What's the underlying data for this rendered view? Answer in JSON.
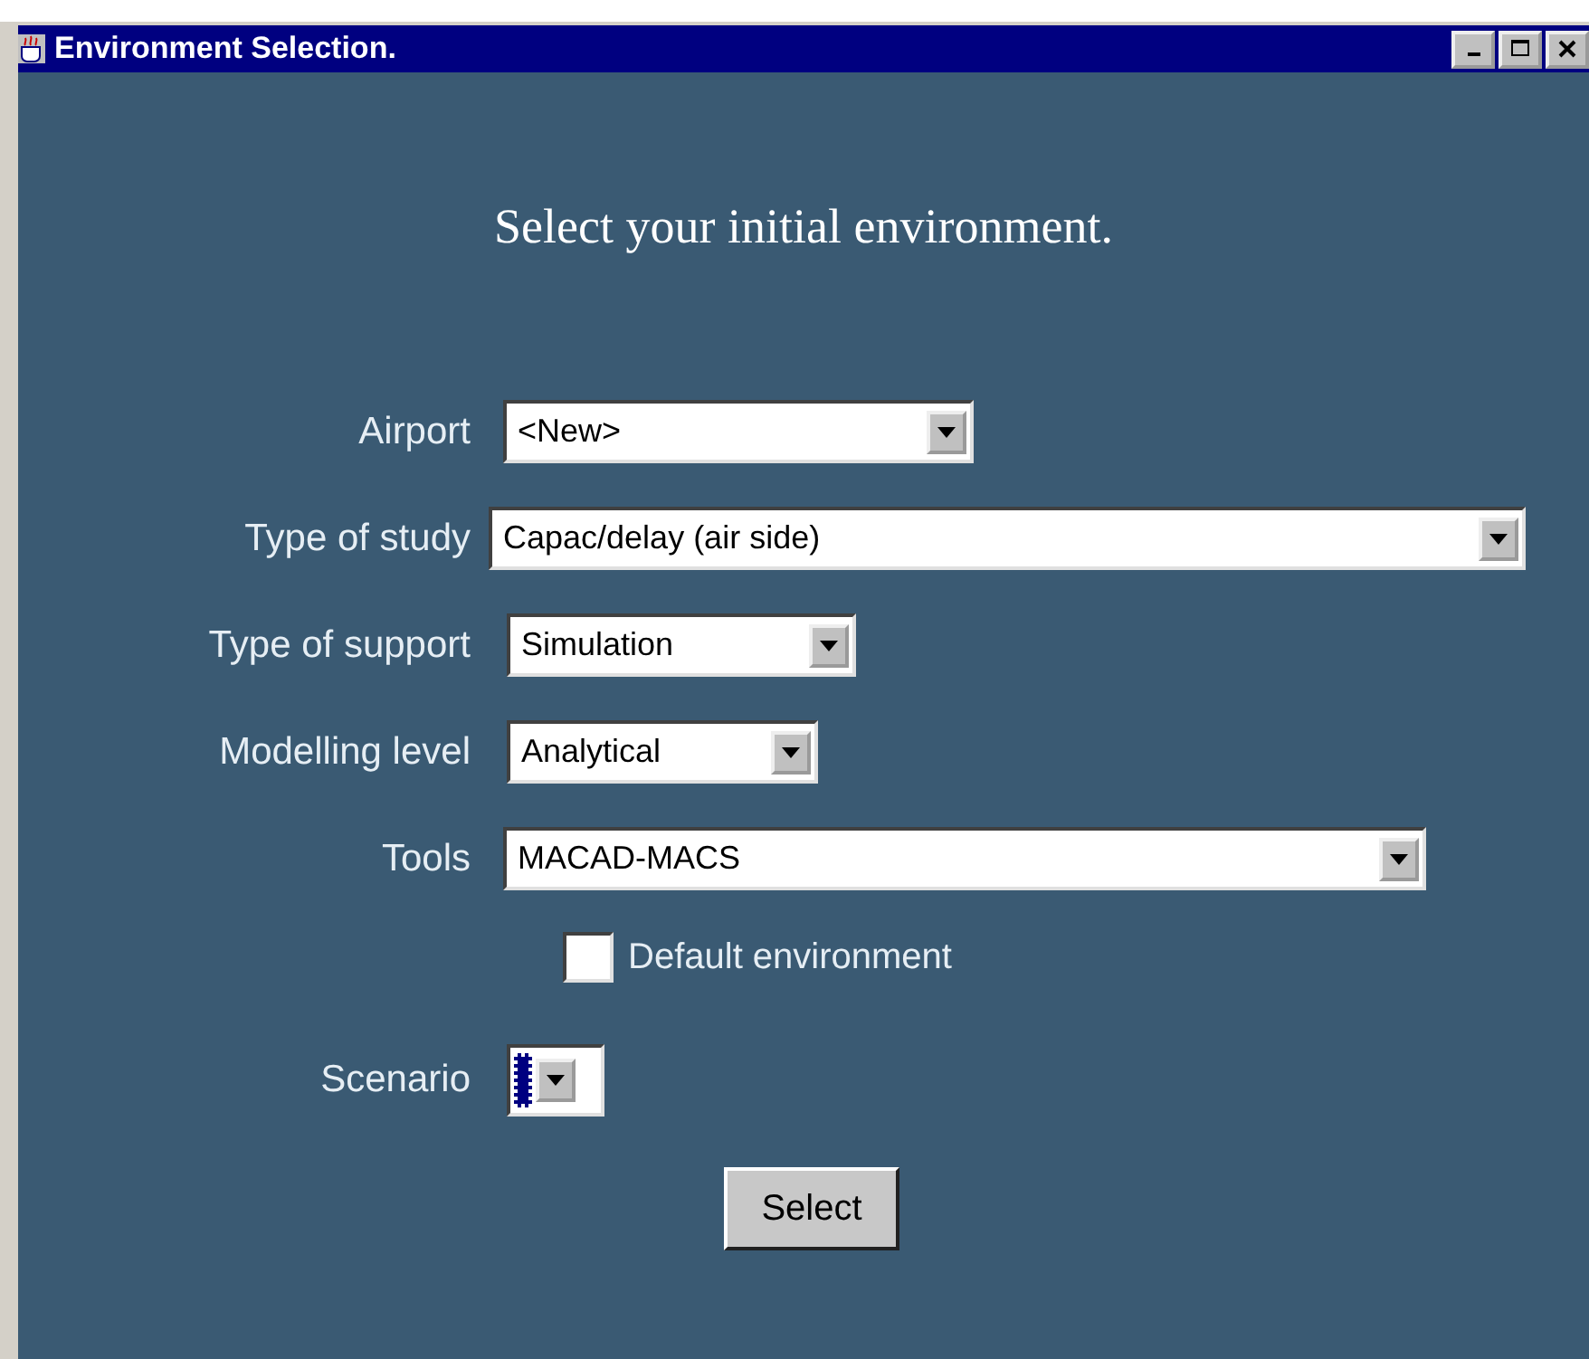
{
  "window": {
    "title": "Environment Selection."
  },
  "heading": "Select your initial environment.",
  "fields": [
    {
      "label": "Airport",
      "value": "<New>"
    },
    {
      "label": "Type of study",
      "value": "Capac/delay (air side)"
    },
    {
      "label": "Type of support",
      "value": "Simulation"
    },
    {
      "label": "Modelling level",
      "value": "Analytical"
    },
    {
      "label": "Tools",
      "value": "MACAD-MACS"
    }
  ],
  "checkbox": {
    "label": "Default environment",
    "checked": false
  },
  "scenario": {
    "label": "Scenario",
    "focused": true
  },
  "button": "Select"
}
